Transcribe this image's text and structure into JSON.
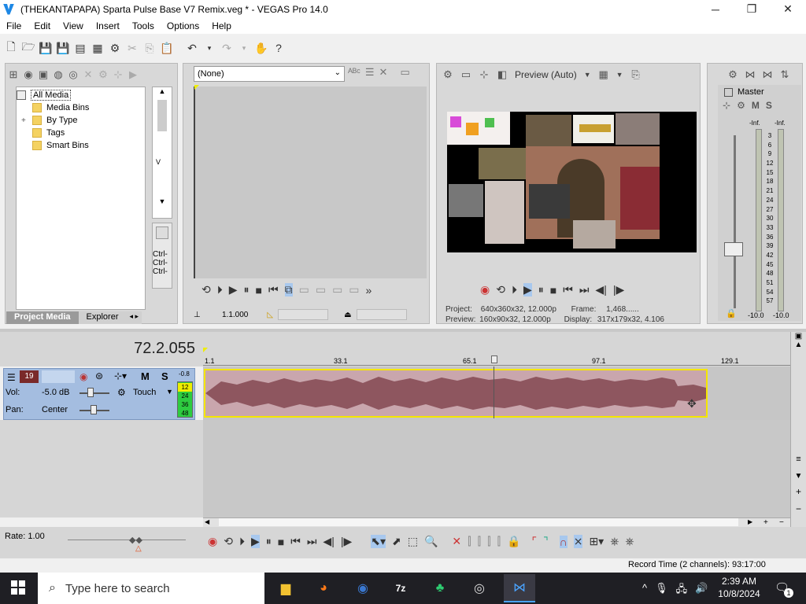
{
  "window": {
    "title": "(THEKANTAPAPA) Sparta Pulse Base V7 Remix.veg * - VEGAS Pro 14.0",
    "minimize": "─",
    "maximize": "❐",
    "close": "✕"
  },
  "menu": [
    "File",
    "Edit",
    "View",
    "Insert",
    "Tools",
    "Options",
    "Help"
  ],
  "project_media": {
    "tree": [
      "All Media",
      "Media Bins",
      "By Type",
      "Tags",
      "Smart Bins"
    ],
    "expander": "+",
    "tabs": [
      "Project Media",
      "Explorer"
    ],
    "letter": "V",
    "shortcuts": [
      "Ctrl-",
      "Ctrl-",
      "Ctrl-"
    ]
  },
  "trimmer": {
    "dropdown": "(None)",
    "timecode": "1.1.000"
  },
  "preview": {
    "mode": "Preview (Auto)",
    "project_label": "Project:",
    "project_value": "640x360x32, 12.000p",
    "preview_label": "Preview:",
    "preview_value": "160x90x32, 12.000p",
    "frame_label": "Frame:",
    "frame_value": "1,468......",
    "display_label": "Display:",
    "display_value": "317x179x32, 4.106"
  },
  "master": {
    "title": "Master",
    "m": "M",
    "s": "S",
    "peak_left": "-Inf.",
    "peak_right": "-Inf.",
    "scale": [
      "3",
      "6",
      "9",
      "12",
      "15",
      "18",
      "21",
      "24",
      "27",
      "30",
      "33",
      "36",
      "39",
      "42",
      "45",
      "48",
      "51",
      "54",
      "57"
    ],
    "bottom_left": "-10.0",
    "bottom_right": "-10.0"
  },
  "timeline": {
    "cursor_time": "72.2.055",
    "ruler": [
      "1.1",
      "33.1",
      "65.1",
      "97.1",
      "129.1"
    ],
    "track": {
      "number": "19",
      "m": "M",
      "s": "S",
      "vol_label": "Vol:",
      "vol_value": "-5.0 dB",
      "pan_label": "Pan:",
      "pan_value": "Center",
      "automation": "Touch",
      "meter_top": "-0.8",
      "meter_scale": [
        "12",
        "24",
        "36",
        "48"
      ]
    },
    "rate": "Rate: 1.00",
    "record_time": "Record Time (2 channels): 93:17:00"
  },
  "taskbar": {
    "search_placeholder": "Type here to search",
    "time": "2:39 AM",
    "date": "10/8/2024",
    "notif_count": "1"
  }
}
